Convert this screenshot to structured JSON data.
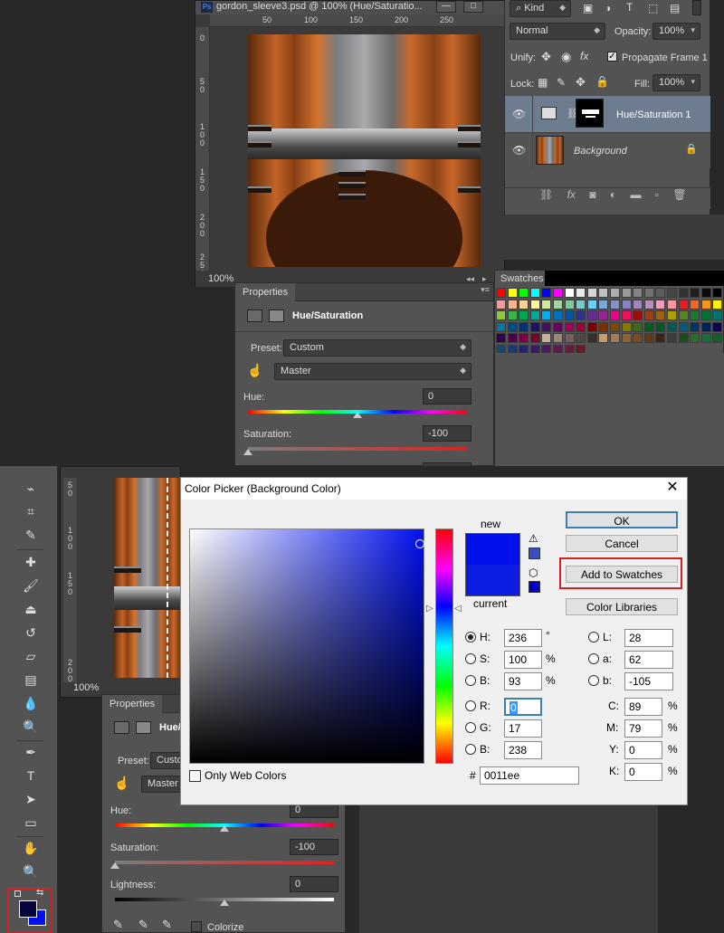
{
  "top": {
    "doc": {
      "tab_label": "gordon_sleeve3.psd @ 100% (Hue/Saturatio...",
      "ps_badge": "Ps",
      "minimize": "—",
      "restore": "□",
      "ruler_h": [
        "50",
        "100",
        "150",
        "200",
        "250"
      ],
      "ruler_v": [
        "0",
        "50",
        "100",
        "150",
        "200",
        "250"
      ],
      "zoom": "100%"
    },
    "layers": {
      "filter_kind": "Kind",
      "blend_mode": "Normal",
      "opacity_label": "Opacity:",
      "opacity_value": "100%",
      "unify_label": "Unify:",
      "propagate_label": "Propagate Frame 1",
      "lock_label": "Lock:",
      "fill_label": "Fill:",
      "fill_value": "100%",
      "items": [
        {
          "name": "Hue/Saturation 1"
        },
        {
          "name": "Background"
        }
      ]
    },
    "properties": {
      "tab": "Properties",
      "title": "Hue/Saturation",
      "preset_label": "Preset:",
      "preset_value": "Custom",
      "channel_value": "Master",
      "hue_label": "Hue:",
      "hue_value": "0",
      "saturation_label": "Saturation:",
      "saturation_value": "-100"
    },
    "swatches": {
      "tab": "Swatches",
      "colors": [
        "#ff0000",
        "#ffff00",
        "#00ff00",
        "#00ffff",
        "#0000ff",
        "#ff00ff",
        "#ffffff",
        "#ebebeb",
        "#d6d6d6",
        "#c2c2c2",
        "#adadad",
        "#999999",
        "#858585",
        "#707070",
        "#5c5c5c",
        "#474747",
        "#333333",
        "#1f1f1f",
        "#0a0a0a",
        "#000000",
        "#f29c9c",
        "#f5b891",
        "#f9d493",
        "#fff799",
        "#d1e89b",
        "#a3d39c",
        "#81ca9d",
        "#7accc8",
        "#6dcff6",
        "#7da7d9",
        "#8393ca",
        "#8781bd",
        "#a186be",
        "#bd8cbf",
        "#f49ac2",
        "#f6989d",
        "#ed1c24",
        "#f26522",
        "#f7941d",
        "#fff200",
        "#8dc63f",
        "#39b54a",
        "#00a651",
        "#00a99d",
        "#00aeef",
        "#0072bc",
        "#0054a6",
        "#2e3192",
        "#662d91",
        "#92278f",
        "#ec008c",
        "#ed145b",
        "#9e0b0f",
        "#a0410d",
        "#a3620a",
        "#aba000",
        "#598527",
        "#1a7b30",
        "#007236",
        "#00746b",
        "#0076a3",
        "#004b80",
        "#003471",
        "#1b1464",
        "#440e62",
        "#630460",
        "#9e005d",
        "#9e0039",
        "#790000",
        "#7b2e00",
        "#7d4900",
        "#827b00",
        "#406618",
        "#005e20",
        "#005826",
        "#005952",
        "#005b7f",
        "#003663",
        "#002157",
        "#0d004c",
        "#32004b",
        "#4b0049",
        "#7b0046",
        "#7a0026",
        "#c7b299",
        "#998675",
        "#736357",
        "#534741",
        "#37302a",
        "#c69c6d",
        "#a67c52",
        "#8c6239",
        "#754c24",
        "#603913",
        "#3c2415",
        "#3d3d3d",
        "#1a4e1a",
        "#2a6b2a",
        "#1a6b3a",
        "#1a5a2a",
        "#144b6b",
        "#1a3a6b",
        "#24246b",
        "#3a1a6b",
        "#4b1a5a",
        "#5a1a4b",
        "#6b1a3a",
        "#6b1a24"
      ]
    }
  },
  "bottom": {
    "doc": {
      "ruler_v": [
        "50",
        "100",
        "150",
        "200"
      ],
      "zoom": "100%"
    },
    "properties": {
      "tab": "Properties",
      "title": "Hue/",
      "preset_label": "Preset:",
      "preset_value": "Custo",
      "channel_value": "Master",
      "hue_label": "Hue:",
      "hue_value": "0",
      "saturation_label": "Saturation:",
      "saturation_value": "-100",
      "lightness_label": "Lightness:",
      "lightness_value": "0",
      "colorize_label": "Colorize"
    },
    "color_picker": {
      "title": "Color Picker (Background Color)",
      "close": "✕",
      "new_label": "new",
      "current_label": "current",
      "new_color": "#0011ee",
      "current_color": "#0b1de0",
      "buttons": {
        "ok": "OK",
        "cancel": "Cancel",
        "add_to_swatches": "Add to Swatches",
        "color_libraries": "Color Libraries"
      },
      "only_web_colors": "Only Web Colors",
      "hsb": {
        "h_label": "H:",
        "h": "236",
        "h_unit": "°",
        "s_label": "S:",
        "s": "100",
        "s_unit": "%",
        "b_label": "B:",
        "b": "93",
        "b_unit": "%"
      },
      "rgb": {
        "r_label": "R:",
        "r": "0",
        "g_label": "G:",
        "g": "17",
        "b_label": "B:",
        "b": "238"
      },
      "lab": {
        "l_label": "L:",
        "l": "28",
        "a_label": "a:",
        "a": "62",
        "b_label": "b:",
        "b": "-105"
      },
      "cmyk": {
        "c_label": "C:",
        "c": "89",
        "m_label": "M:",
        "m": "79",
        "y_label": "Y:",
        "y": "0",
        "k_label": "K:",
        "k": "0",
        "unit": "%"
      },
      "hex_label": "#",
      "hex": "0011ee"
    },
    "toolbar": {
      "foreground_color": "#06063a",
      "background_color": "#0011ee"
    }
  }
}
